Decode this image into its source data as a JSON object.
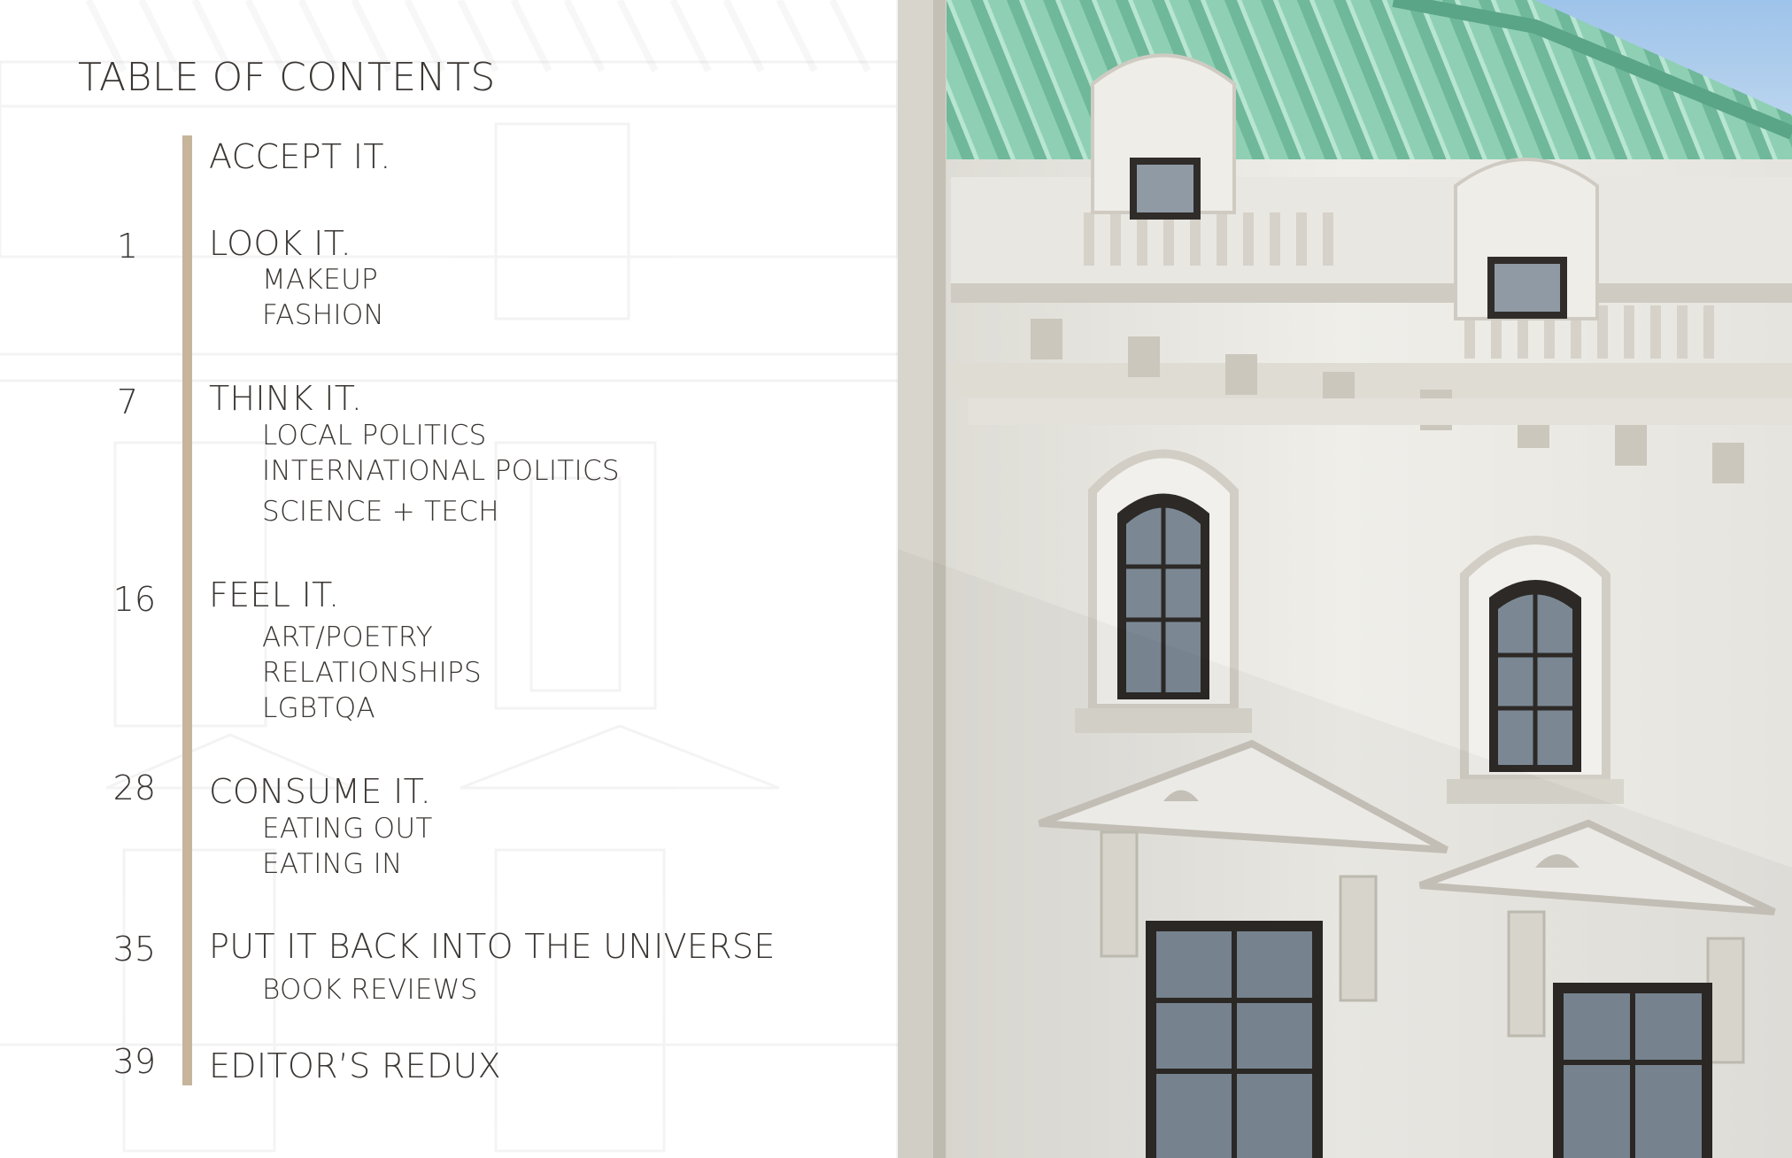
{
  "toc": {
    "title": "TABLE OF CONTENTS",
    "sections": [
      {
        "page": "",
        "title": "ACCEPT IT.",
        "subs": []
      },
      {
        "page": "1",
        "title": "LOOK IT.",
        "subs": [
          "MAKEUP",
          "FASHION"
        ]
      },
      {
        "page": "7",
        "title": "THINK IT.",
        "subs": [
          "LOCAL POLITICS",
          "INTERNATIONAL POLITICS",
          "SCIENCE + TECH"
        ]
      },
      {
        "page": "16",
        "title": "FEEL IT.",
        "subs": [
          "ART/POETRY",
          "RELATIONSHIPS",
          "LGBTQA"
        ]
      },
      {
        "page": "28",
        "title": "CONSUME IT.",
        "subs": [
          "EATING OUT",
          "EATING IN"
        ]
      },
      {
        "page": "35",
        "title": "PUT IT BACK INTO THE UNIVERSE",
        "subs": [
          "BOOK REVIEWS"
        ]
      },
      {
        "page": "39",
        "title": "EDITOR’S REDUX",
        "subs": []
      }
    ]
  },
  "colors": {
    "accent_bar": "#c6b59b",
    "text": "#3a3633",
    "roof": "#7fc4a8",
    "sky": "#a9c8e8",
    "facade": "#ecebe5"
  },
  "photo": {
    "subject": "building-facade-photo"
  }
}
